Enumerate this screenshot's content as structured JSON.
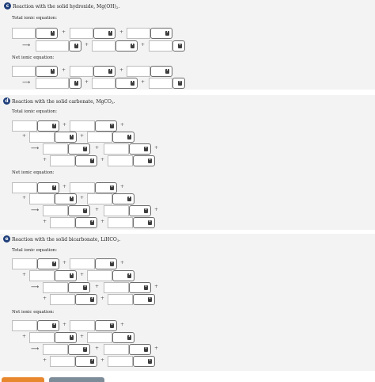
{
  "sections": {
    "c": {
      "letter": "c",
      "title": "Reaction with the solid hydroxide, Mg(OH)",
      "title_sub": "2",
      "title_end": ".",
      "total_label": "Total ionic equation:",
      "net_label": "Net ionic equation:"
    },
    "d": {
      "letter": "d",
      "title": "Reaction with the solid carbonate, MgCO",
      "title_sub": "3",
      "title_end": ".",
      "total_label": "Total ionic equation:",
      "net_label": "Net ionic equation:"
    },
    "e": {
      "letter": "e",
      "title": "Reaction with the solid bicarbonate, LiHCO",
      "title_sub": "3",
      "title_end": ".",
      "total_label": "Total ionic equation:",
      "net_label": "Net ionic equation:"
    }
  },
  "symbols": {
    "plus": "+",
    "arrow": "⟶",
    "chevron": "⬍"
  },
  "icons": {
    "dropdown": "updown-chevron-icon"
  },
  "colors": {
    "badge": "#1f3f7a",
    "panel": "#f3f3f3",
    "submit": "#e8882e",
    "try_again": "#7d8c99"
  }
}
